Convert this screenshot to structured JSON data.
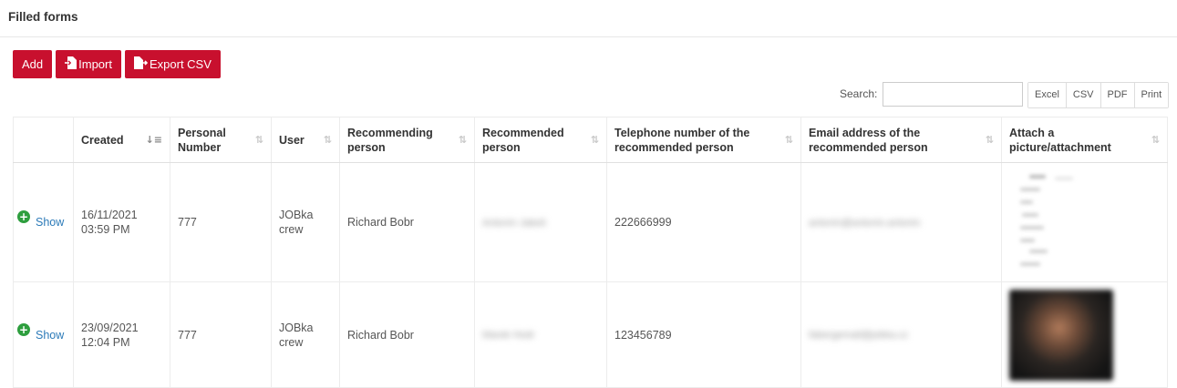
{
  "page": {
    "title": "Filled forms"
  },
  "toolbar": {
    "add_label": "Add",
    "import_label": "Import",
    "export_csv_label": "Export CSV"
  },
  "search": {
    "label": "Search:",
    "value": ""
  },
  "export_buttons": [
    "Excel",
    "CSV",
    "PDF",
    "Print"
  ],
  "table": {
    "columns": [
      "",
      "Created",
      "Personal Number",
      "User",
      "Recommending person",
      "Recommended person",
      "Telephone number of the recommended person",
      "Email address of the recommended person",
      "Attach a picture/attachment"
    ],
    "rows": [
      {
        "action": "Show",
        "created": "16/11/2021 03:59 PM",
        "personal_number": "777",
        "user": "JOBka crew",
        "recommending": "Richard Bobr",
        "recommended": "Antonín Jakeš",
        "phone": "222666999",
        "email": "antonin@antonin.antonin",
        "attachment": "document"
      },
      {
        "action": "Show",
        "created": "23/09/2021 12:04 PM",
        "personal_number": "777",
        "user": "JOBka crew",
        "recommending": "Richard Bobr",
        "recommended": "Marek Hodr",
        "phone": "123456789",
        "email": "fabergemail@jobka.cz",
        "attachment": "photo"
      }
    ]
  },
  "colors": {
    "accent": "#c8102e",
    "link": "#2b7ab8",
    "plus_icon": "#2e9e3e"
  }
}
